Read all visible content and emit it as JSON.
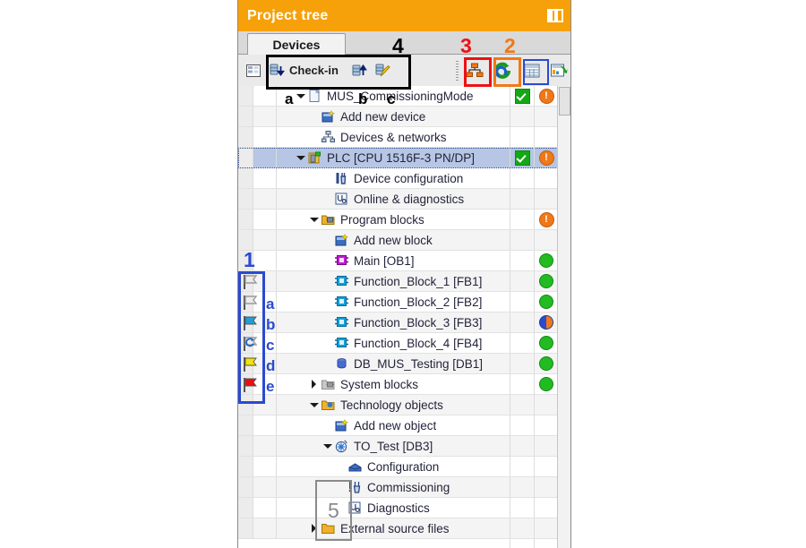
{
  "panel": {
    "title": "Project tree",
    "panel_icon": "split-panel-icon",
    "tab": "Devices"
  },
  "toolbar": {
    "items": [
      {
        "name": "project-overview-icon",
        "label": ""
      },
      {
        "name": "check-in-icon",
        "label": "Check-in"
      },
      {
        "name": "check-out-icon",
        "label": ""
      },
      {
        "name": "edit-in-place-icon",
        "label": ""
      },
      {
        "name": "topology-view-icon",
        "label": ""
      },
      {
        "name": "go-online-icon",
        "label": ""
      },
      {
        "name": "tag-table-icon",
        "label": ""
      },
      {
        "name": "export-table-icon",
        "label": ""
      }
    ],
    "check_in_label": "Check-in"
  },
  "tree": {
    "rows": [
      {
        "indent": 1,
        "twisty": "down",
        "icon": "project-icon",
        "label": "MUS_CommissioningMode",
        "check": true,
        "warn": true,
        "dot": "none",
        "selected": false
      },
      {
        "indent": 2,
        "twisty": "none",
        "icon": "add-new-device-icon",
        "label": "Add new device",
        "check": false,
        "warn": false,
        "dot": "none",
        "selected": false
      },
      {
        "indent": 2,
        "twisty": "none",
        "icon": "devices-networks-icon",
        "label": "Devices & networks",
        "check": false,
        "warn": false,
        "dot": "none",
        "selected": false
      },
      {
        "indent": 1,
        "twisty": "down",
        "icon": "plc-icon",
        "label": "PLC [CPU 1516F-3 PN/DP]",
        "check": true,
        "warn": true,
        "dot": "none",
        "selected": true
      },
      {
        "indent": 3,
        "twisty": "none",
        "icon": "device-config-icon",
        "label": "Device configuration",
        "check": false,
        "warn": false,
        "dot": "none",
        "selected": false
      },
      {
        "indent": 3,
        "twisty": "none",
        "icon": "online-diag-icon",
        "label": "Online & diagnostics",
        "check": false,
        "warn": false,
        "dot": "none",
        "selected": false
      },
      {
        "indent": 2,
        "twisty": "down",
        "icon": "program-blocks-icon",
        "label": "Program blocks",
        "check": false,
        "warn": true,
        "dot": "none",
        "selected": false
      },
      {
        "indent": 3,
        "twisty": "none",
        "icon": "add-new-block-icon",
        "label": "Add new block",
        "check": false,
        "warn": false,
        "dot": "none",
        "selected": false
      },
      {
        "indent": 3,
        "twisty": "none",
        "icon": "ob-block-icon",
        "label": "Main [OB1]",
        "check": false,
        "warn": false,
        "dot": "green",
        "selected": false
      },
      {
        "indent": 3,
        "twisty": "none",
        "icon": "fb-block-icon",
        "label": "Function_Block_1 [FB1]",
        "check": false,
        "warn": false,
        "dot": "green",
        "selected": false
      },
      {
        "indent": 3,
        "twisty": "none",
        "icon": "fb-block-icon",
        "label": "Function_Block_2 [FB2]",
        "check": false,
        "warn": false,
        "dot": "green",
        "selected": false
      },
      {
        "indent": 3,
        "twisty": "none",
        "icon": "fb-block-icon",
        "label": "Function_Block_3 [FB3]",
        "check": false,
        "warn": false,
        "dot": "half",
        "selected": false
      },
      {
        "indent": 3,
        "twisty": "none",
        "icon": "fb-block-icon",
        "label": "Function_Block_4 [FB4]",
        "check": false,
        "warn": false,
        "dot": "green",
        "selected": false
      },
      {
        "indent": 3,
        "twisty": "none",
        "icon": "db-block-icon",
        "label": "DB_MUS_Testing [DB1]",
        "check": false,
        "warn": false,
        "dot": "green",
        "selected": false
      },
      {
        "indent": 2,
        "twisty": "right",
        "icon": "system-blocks-icon",
        "label": "System blocks",
        "check": false,
        "warn": false,
        "dot": "green",
        "selected": false
      },
      {
        "indent": 2,
        "twisty": "down",
        "icon": "tech-objects-icon",
        "label": "Technology objects",
        "check": false,
        "warn": false,
        "dot": "none",
        "selected": false
      },
      {
        "indent": 3,
        "twisty": "none",
        "icon": "add-new-object-icon",
        "label": "Add new object",
        "check": false,
        "warn": false,
        "dot": "none",
        "selected": false
      },
      {
        "indent": 3,
        "twisty": "down",
        "icon": "to-object-icon",
        "label": "TO_Test [DB3]",
        "check": false,
        "warn": false,
        "dot": "none",
        "selected": false
      },
      {
        "indent": 4,
        "twisty": "none",
        "icon": "configuration-icon",
        "label": "Configuration",
        "check": false,
        "warn": false,
        "dot": "none",
        "selected": false
      },
      {
        "indent": 4,
        "twisty": "none",
        "icon": "commissioning-icon",
        "label": "Commissioning",
        "check": false,
        "warn": false,
        "dot": "none",
        "selected": false
      },
      {
        "indent": 4,
        "twisty": "none",
        "icon": "diagnostics-icon",
        "label": "Diagnostics",
        "check": false,
        "warn": false,
        "dot": "none",
        "selected": false
      },
      {
        "indent": 2,
        "twisty": "right",
        "icon": "folder-icon",
        "label": "External source files",
        "check": false,
        "warn": false,
        "dot": "none",
        "selected": false
      }
    ]
  },
  "annotations": {
    "num1": "1",
    "num2": "2",
    "num3": "3",
    "num4": "4",
    "num5": "5",
    "toolbar_letters": [
      "a",
      "b",
      "c"
    ],
    "flag_letters": [
      "a",
      "b",
      "c",
      "d",
      "e"
    ],
    "colors": {
      "black": "#000000",
      "red": "#ee1111",
      "orange": "#f07818",
      "blue": "#2b4ad0",
      "gray": "#8a8a8a"
    }
  },
  "flags": [
    {
      "name": "flag-outline-gray",
      "fill": "none",
      "kind": "plain"
    },
    {
      "name": "flag-outline-gray",
      "fill": "none",
      "kind": "plain"
    },
    {
      "name": "flag-blue",
      "fill": "#1e9fd8",
      "kind": "plain"
    },
    {
      "name": "flag-sync",
      "fill": "none",
      "kind": "sync"
    },
    {
      "name": "flag-yellow",
      "fill": "#f5e400",
      "kind": "plain"
    },
    {
      "name": "flag-red",
      "fill": "#e81010",
      "kind": "plain"
    }
  ]
}
